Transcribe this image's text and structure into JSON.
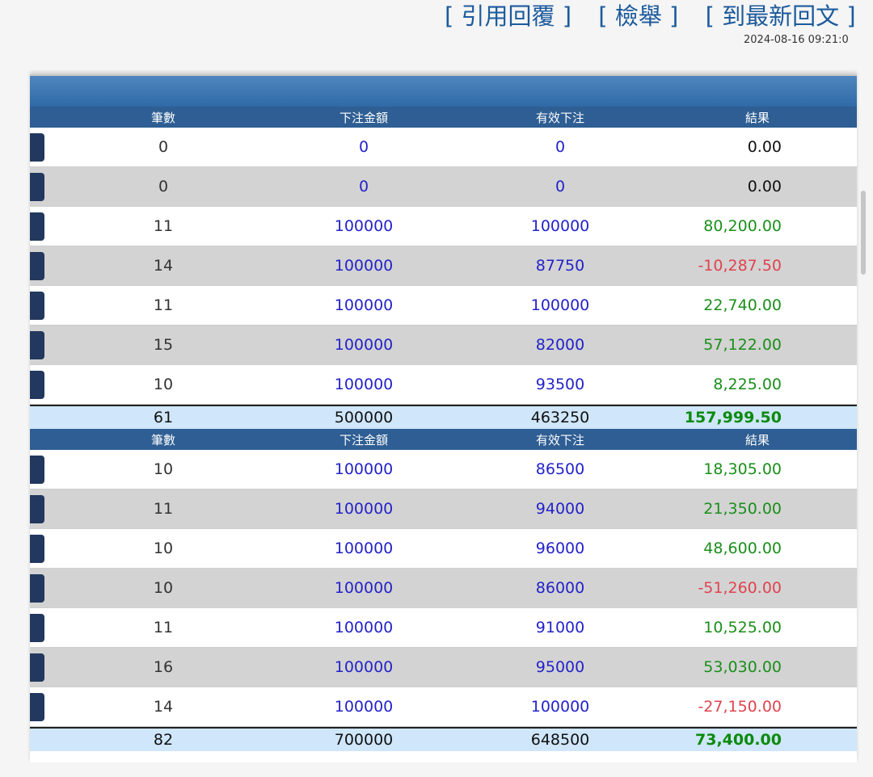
{
  "actions": {
    "reply_quote": "[ 引用回覆 ]",
    "report": "[ 檢舉 ]",
    "latest": "[ 到最新回文 ]"
  },
  "timestamp": "2024-08-16 09:21:0",
  "columns": {
    "count": "筆數",
    "bet_amount": "下注金額",
    "effective_bet": "有效下注",
    "result": "結果"
  },
  "table1": {
    "rows": [
      {
        "count": "0",
        "bet": "0",
        "effective": "0",
        "result": "0.00",
        "sign": "zero"
      },
      {
        "count": "0",
        "bet": "0",
        "effective": "0",
        "result": "0.00",
        "sign": "zero"
      },
      {
        "count": "11",
        "bet": "100000",
        "effective": "100000",
        "result": "80,200.00",
        "sign": "pos"
      },
      {
        "count": "14",
        "bet": "100000",
        "effective": "87750",
        "result": "-10,287.50",
        "sign": "neg"
      },
      {
        "count": "11",
        "bet": "100000",
        "effective": "100000",
        "result": "22,740.00",
        "sign": "pos"
      },
      {
        "count": "15",
        "bet": "100000",
        "effective": "82000",
        "result": "57,122.00",
        "sign": "pos"
      },
      {
        "count": "10",
        "bet": "100000",
        "effective": "93500",
        "result": "8,225.00",
        "sign": "pos"
      }
    ],
    "total": {
      "count": "61",
      "bet": "500000",
      "effective": "463250",
      "result": "157,999.50"
    }
  },
  "table2": {
    "rows": [
      {
        "count": "10",
        "bet": "100000",
        "effective": "86500",
        "result": "18,305.00",
        "sign": "pos"
      },
      {
        "count": "11",
        "bet": "100000",
        "effective": "94000",
        "result": "21,350.00",
        "sign": "pos"
      },
      {
        "count": "10",
        "bet": "100000",
        "effective": "96000",
        "result": "48,600.00",
        "sign": "pos"
      },
      {
        "count": "10",
        "bet": "100000",
        "effective": "86000",
        "result": "-51,260.00",
        "sign": "neg"
      },
      {
        "count": "11",
        "bet": "100000",
        "effective": "91000",
        "result": "10,525.00",
        "sign": "pos"
      },
      {
        "count": "16",
        "bet": "100000",
        "effective": "95000",
        "result": "53,030.00",
        "sign": "pos"
      },
      {
        "count": "14",
        "bet": "100000",
        "effective": "100000",
        "result": "-27,150.00",
        "sign": "neg"
      }
    ],
    "total": {
      "count": "82",
      "bet": "700000",
      "effective": "648500",
      "result": "73,400.00"
    }
  },
  "colors": {
    "header_bg": "#2e5e93",
    "link": "#1c5a9c",
    "positive": "#1a8f1a",
    "negative": "#e0434f",
    "amount": "#2323c9",
    "total_bg": "#cfe6fb"
  }
}
